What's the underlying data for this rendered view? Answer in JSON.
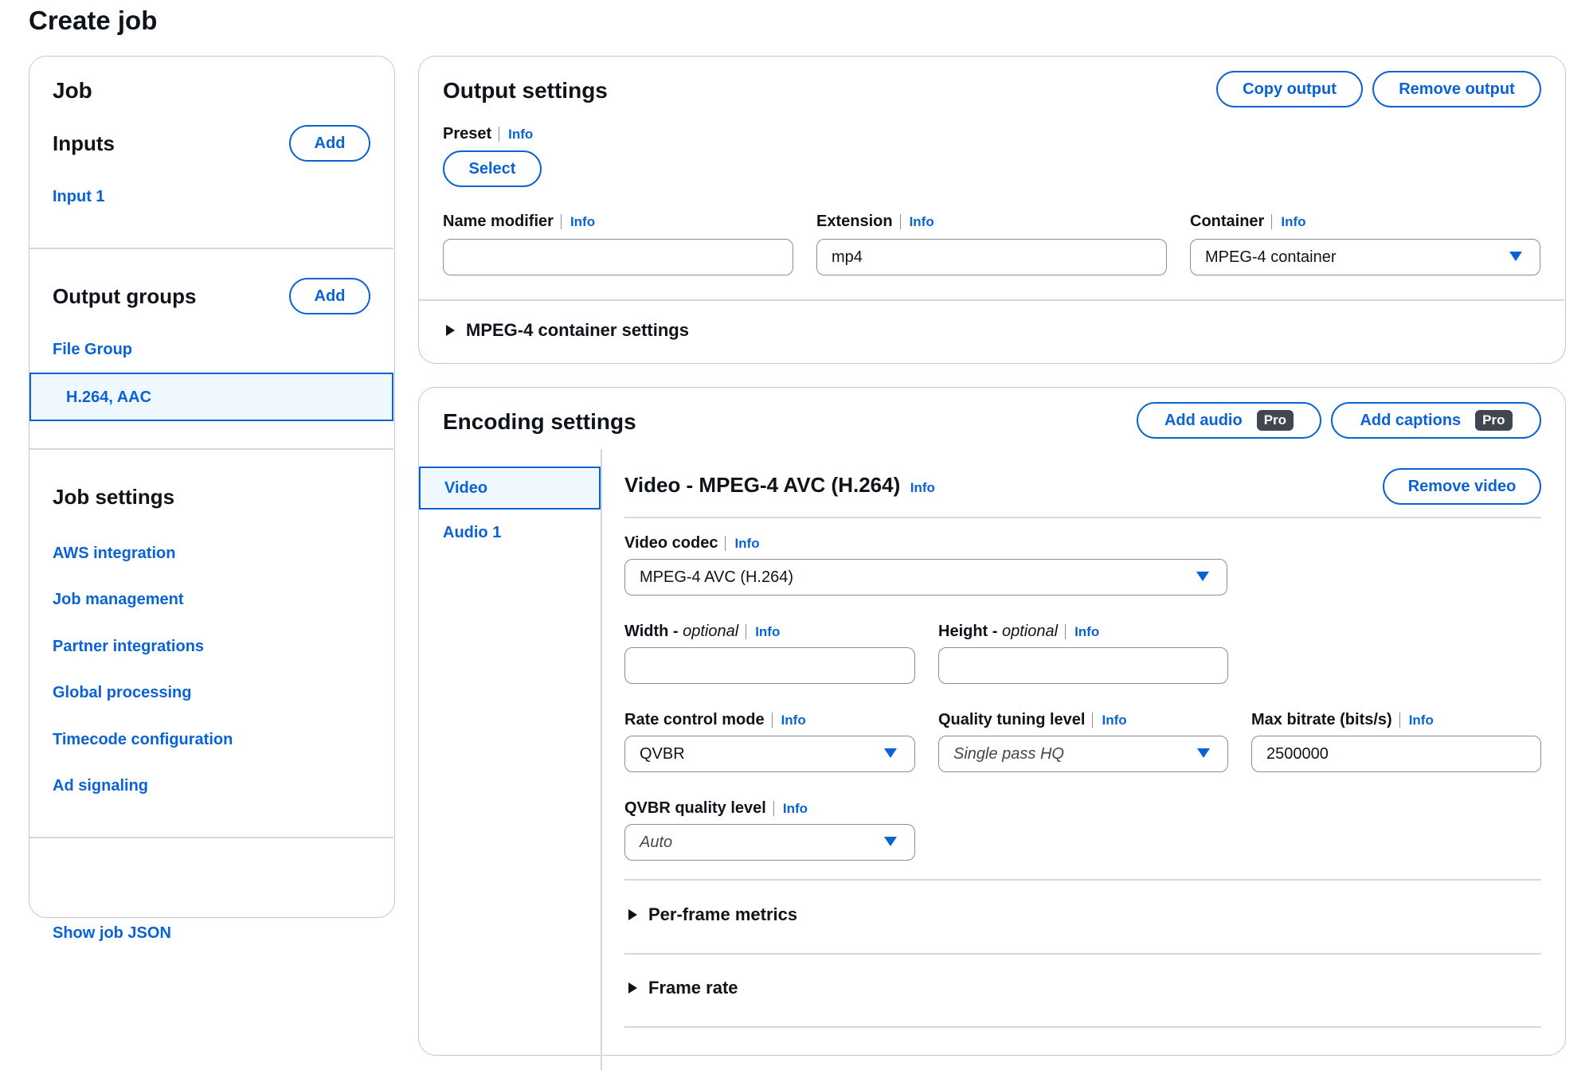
{
  "page": {
    "title": "Create job"
  },
  "sidebar": {
    "job_heading": "Job",
    "inputs_heading": "Inputs",
    "inputs_add": "Add",
    "input_item": "Input 1",
    "output_groups_heading": "Output groups",
    "output_groups_add": "Add",
    "file_group": "File Group",
    "selected_output": "H.264, AAC",
    "job_settings_heading": "Job settings",
    "job_settings_items": [
      "AWS integration",
      "Job management",
      "Partner integrations",
      "Global processing",
      "Timecode configuration",
      "Ad signaling"
    ],
    "show_json": "Show job JSON"
  },
  "output_settings": {
    "title": "Output settings",
    "copy_output": "Copy output",
    "remove_output": "Remove output",
    "preset_label": "Preset",
    "info": "Info",
    "select_button": "Select",
    "name_modifier_label": "Name modifier",
    "name_modifier_value": "",
    "extension_label": "Extension",
    "extension_value": "mp4",
    "container_label": "Container",
    "container_value": "MPEG-4 container",
    "container_settings": "MPEG-4 container settings"
  },
  "encoding_settings": {
    "title": "Encoding settings",
    "add_audio": "Add audio",
    "add_captions": "Add captions",
    "pro_badge": "Pro",
    "tabs": [
      "Video",
      "Audio 1"
    ],
    "video_title": "Video - MPEG-4 AVC (H.264)",
    "remove_video": "Remove video",
    "info": "Info",
    "video_codec_label": "Video codec",
    "video_codec_value": "MPEG-4 AVC (H.264)",
    "width_label": "Width - ",
    "height_label": "Height - ",
    "optional": "optional",
    "width_value": "",
    "height_value": "",
    "rate_control_label": "Rate control mode",
    "rate_control_value": "QVBR",
    "quality_tuning_label": "Quality tuning level",
    "quality_tuning_value": "Single pass HQ",
    "max_bitrate_label": "Max bitrate (bits/s)",
    "max_bitrate_value": "2500000",
    "qvbr_label": "QVBR quality level",
    "qvbr_value": "Auto",
    "per_frame_metrics": "Per-frame metrics",
    "frame_rate": "Frame rate"
  },
  "colors": {
    "link": "#0a63d4",
    "border": "#c6c6cd",
    "text": "#0f141a",
    "pro_badge_bg": "#424650"
  }
}
